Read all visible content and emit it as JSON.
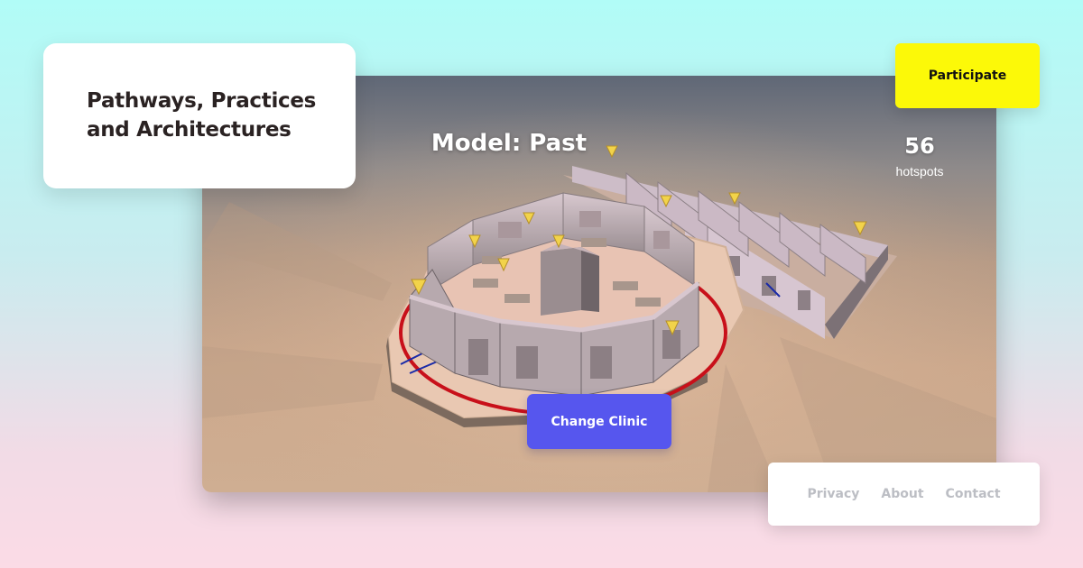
{
  "site": {
    "title": "Pathways, Practices and Architectures"
  },
  "header": {
    "participate_label": "Participate"
  },
  "viewer": {
    "model_title": "Model: Past",
    "hotspot_count": "56",
    "hotspot_label": "hotspots",
    "change_clinic_label": "Change Clinic",
    "hotspot_marker_icon": "cone-marker-icon"
  },
  "footer": {
    "links": [
      {
        "label": "Privacy"
      },
      {
        "label": "About"
      },
      {
        "label": "Contact"
      }
    ]
  },
  "colors": {
    "background_top": "#b1fcf7",
    "background_bottom": "#fbdbe6",
    "participate_bg": "#fcf908",
    "change_clinic_bg": "#5656ee",
    "footer_link": "#bcbec4",
    "pathway_red": "#c8101a",
    "pathway_blue": "#1a2aa8",
    "hotspot_yellow": "#f2d34a"
  }
}
